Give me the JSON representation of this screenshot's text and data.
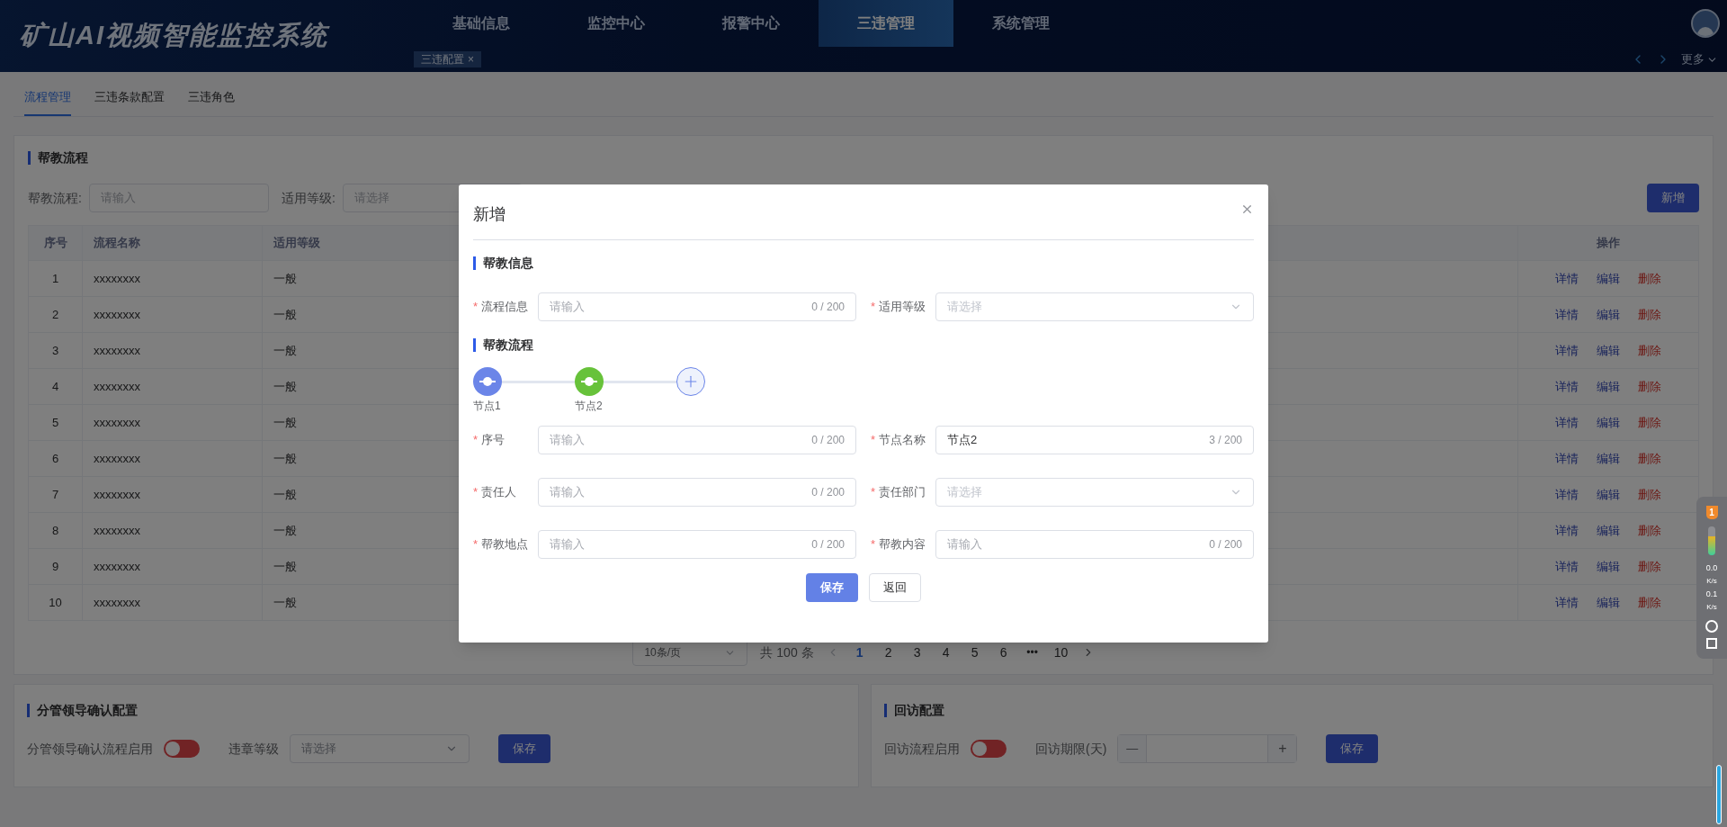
{
  "header": {
    "title": "矿山AI视频智能监控系统",
    "nav": [
      {
        "label": "基础信息",
        "selected": false
      },
      {
        "label": "监控中心",
        "selected": false
      },
      {
        "label": "报警中心",
        "selected": false
      },
      {
        "label": "三违管理",
        "selected": true
      },
      {
        "label": "系统管理",
        "selected": false
      }
    ],
    "tags": [
      {
        "label": "三违配置",
        "close": "×"
      }
    ],
    "more": "更多"
  },
  "tabs": [
    {
      "label": "流程管理",
      "selected": true
    },
    {
      "label": "三违条款配置",
      "selected": false
    },
    {
      "label": "三违角色",
      "selected": false
    }
  ],
  "process_panel": {
    "title": "帮教流程",
    "filters": [
      {
        "label": "帮教流程:",
        "kind": "input",
        "placeholder": "请输入"
      },
      {
        "label": "适用等级:",
        "kind": "select",
        "placeholder": "请选择"
      }
    ],
    "add_button": "新增",
    "table": {
      "columns": [
        "序号",
        "流程名称",
        "适用等级",
        "操作"
      ],
      "rows": [
        {
          "index": "1",
          "name": "xxxxxxxx",
          "level": "一般",
          "actions": [
            {
              "label": "详情",
              "kind": "link"
            },
            {
              "label": "编辑",
              "kind": "link"
            },
            {
              "label": "删除",
              "kind": "danger"
            }
          ]
        },
        {
          "index": "2",
          "name": "xxxxxxxx",
          "level": "一般",
          "actions": [
            {
              "label": "详情",
              "kind": "link"
            },
            {
              "label": "编辑",
              "kind": "link"
            },
            {
              "label": "删除",
              "kind": "danger"
            }
          ]
        },
        {
          "index": "3",
          "name": "xxxxxxxx",
          "level": "一般",
          "actions": [
            {
              "label": "详情",
              "kind": "link"
            },
            {
              "label": "编辑",
              "kind": "link"
            },
            {
              "label": "删除",
              "kind": "danger"
            }
          ]
        },
        {
          "index": "4",
          "name": "xxxxxxxx",
          "level": "一般",
          "actions": [
            {
              "label": "详情",
              "kind": "link"
            },
            {
              "label": "编辑",
              "kind": "link"
            },
            {
              "label": "删除",
              "kind": "danger"
            }
          ]
        },
        {
          "index": "5",
          "name": "xxxxxxxx",
          "level": "一般",
          "actions": [
            {
              "label": "详情",
              "kind": "link"
            },
            {
              "label": "编辑",
              "kind": "link"
            },
            {
              "label": "删除",
              "kind": "danger"
            }
          ]
        },
        {
          "index": "6",
          "name": "xxxxxxxx",
          "level": "一般",
          "actions": [
            {
              "label": "详情",
              "kind": "link"
            },
            {
              "label": "编辑",
              "kind": "link"
            },
            {
              "label": "删除",
              "kind": "danger"
            }
          ]
        },
        {
          "index": "7",
          "name": "xxxxxxxx",
          "level": "一般",
          "actions": [
            {
              "label": "详情",
              "kind": "link"
            },
            {
              "label": "编辑",
              "kind": "link"
            },
            {
              "label": "删除",
              "kind": "danger"
            }
          ]
        },
        {
          "index": "8",
          "name": "xxxxxxxx",
          "level": "一般",
          "actions": [
            {
              "label": "详情",
              "kind": "link"
            },
            {
              "label": "编辑",
              "kind": "link"
            },
            {
              "label": "删除",
              "kind": "danger"
            }
          ]
        },
        {
          "index": "9",
          "name": "xxxxxxxx",
          "level": "一般",
          "actions": [
            {
              "label": "详情",
              "kind": "link"
            },
            {
              "label": "编辑",
              "kind": "link"
            },
            {
              "label": "删除",
              "kind": "danger"
            }
          ]
        },
        {
          "index": "10",
          "name": "xxxxxxxx",
          "level": "一般",
          "actions": [
            {
              "label": "详情",
              "kind": "link"
            },
            {
              "label": "编辑",
              "kind": "link"
            },
            {
              "label": "删除",
              "kind": "danger"
            }
          ]
        }
      ]
    },
    "pagination": {
      "page_size": "10条/页",
      "total": "共 100 条",
      "pages": [
        {
          "label": "1",
          "kind": "page",
          "selected": true
        },
        {
          "label": "2",
          "kind": "page",
          "selected": false
        },
        {
          "label": "3",
          "kind": "page",
          "selected": false
        },
        {
          "label": "4",
          "kind": "page",
          "selected": false
        },
        {
          "label": "5",
          "kind": "page",
          "selected": false
        },
        {
          "label": "6",
          "kind": "page",
          "selected": false
        },
        {
          "label": "•••",
          "kind": "ellipsis",
          "selected": false
        },
        {
          "label": "10",
          "kind": "page",
          "selected": false
        }
      ]
    }
  },
  "confirm_panel": {
    "title": "分管领导确认配置",
    "switch_label": "分管领导确认流程启用",
    "on": false,
    "select_label": "违章等级",
    "select_placeholder": "请选择",
    "save": "保存"
  },
  "revisit_panel": {
    "title": "回访配置",
    "switch_label": "回访流程启用",
    "on": false,
    "number_label": "回访期限(天)",
    "minus": "—",
    "plus": "+",
    "save": "保存"
  },
  "modal": {
    "title": "新增",
    "info_title": "帮教信息",
    "info_fields": [
      {
        "label": "流程信息",
        "marker": "*",
        "kind": "input",
        "placeholder": "请输入",
        "counter": "0 / 200"
      },
      {
        "label": "适用等级",
        "marker": "*",
        "kind": "select",
        "placeholder": "请选择"
      }
    ],
    "flow_title": "帮教流程",
    "nodes": [
      {
        "label": "节点1",
        "selected": false
      },
      {
        "label": "节点2",
        "selected": true
      }
    ],
    "node_fields": [
      {
        "label": "序号",
        "marker": "*",
        "kind": "input",
        "placeholder": "请输入",
        "counter": "0 / 200"
      },
      {
        "label": "节点名称",
        "marker": "*",
        "kind": "input",
        "value": "节点2",
        "counter": "3 / 200"
      },
      {
        "label": "责任人",
        "marker": "*",
        "kind": "input",
        "placeholder": "请输入",
        "counter": "0 / 200"
      },
      {
        "label": "责任部门",
        "marker": "*",
        "kind": "select",
        "placeholder": "请选择"
      },
      {
        "label": "帮教地点",
        "marker": "*",
        "kind": "input",
        "placeholder": "请输入",
        "counter": "0 / 200"
      },
      {
        "label": "帮教内容",
        "marker": "*",
        "kind": "input",
        "placeholder": "请输入",
        "counter": "0 / 200"
      }
    ],
    "save": "保存",
    "back": "返回"
  },
  "speed_widget": {
    "badge": "1",
    "up": "0.0",
    "up_unit": "K/s",
    "down": "0.1",
    "down_unit": "K/s"
  }
}
